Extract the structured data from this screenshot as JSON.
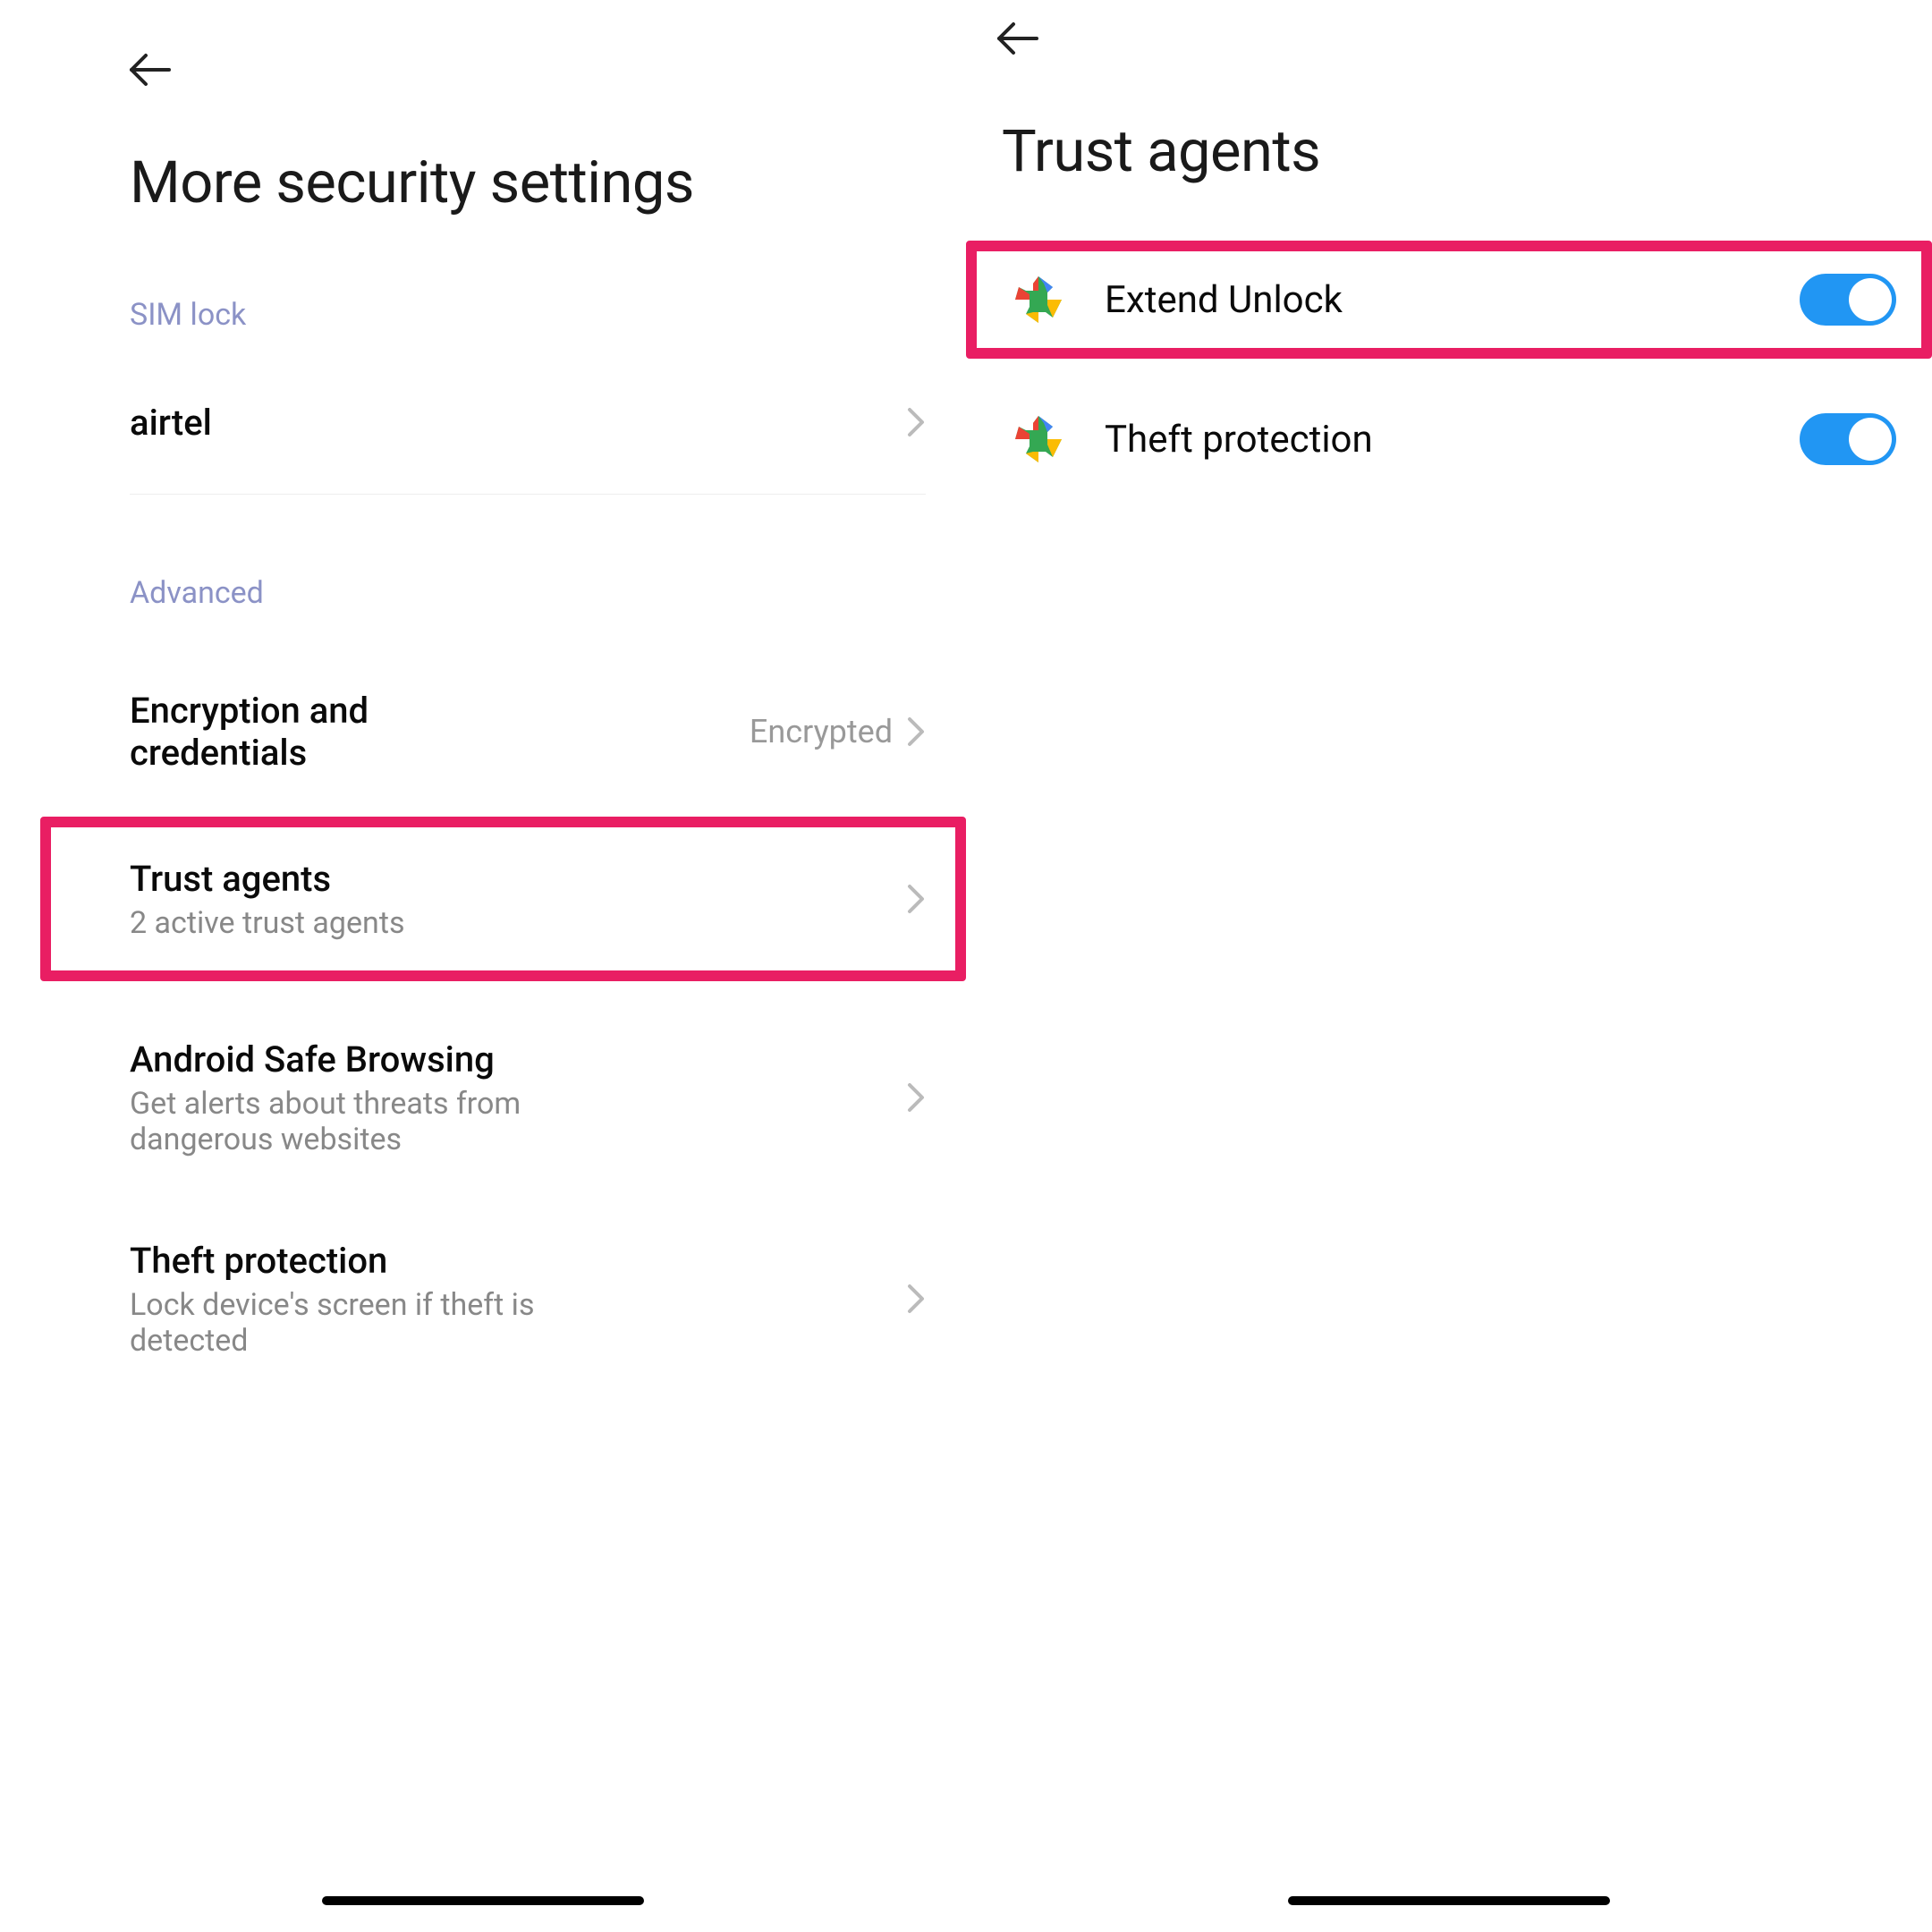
{
  "screen1": {
    "title": "More security settings",
    "sections": {
      "sim_lock": {
        "label": "SIM lock",
        "items": [
          {
            "title": "airtel"
          }
        ]
      },
      "advanced": {
        "label": "Advanced",
        "items": [
          {
            "title": "Encryption and credentials",
            "value": "Encrypted"
          },
          {
            "title": "Trust agents",
            "subtitle": "2 active trust agents"
          },
          {
            "title": "Android Safe Browsing",
            "subtitle": "Get alerts about threats from dangerous websites"
          },
          {
            "title": "Theft protection",
            "subtitle": "Lock device's screen if theft is detected"
          }
        ]
      }
    }
  },
  "screen2": {
    "title": "Trust agents",
    "agents": [
      {
        "title": "Extend Unlock",
        "enabled": true
      },
      {
        "title": "Theft protection",
        "enabled": true
      }
    ]
  }
}
